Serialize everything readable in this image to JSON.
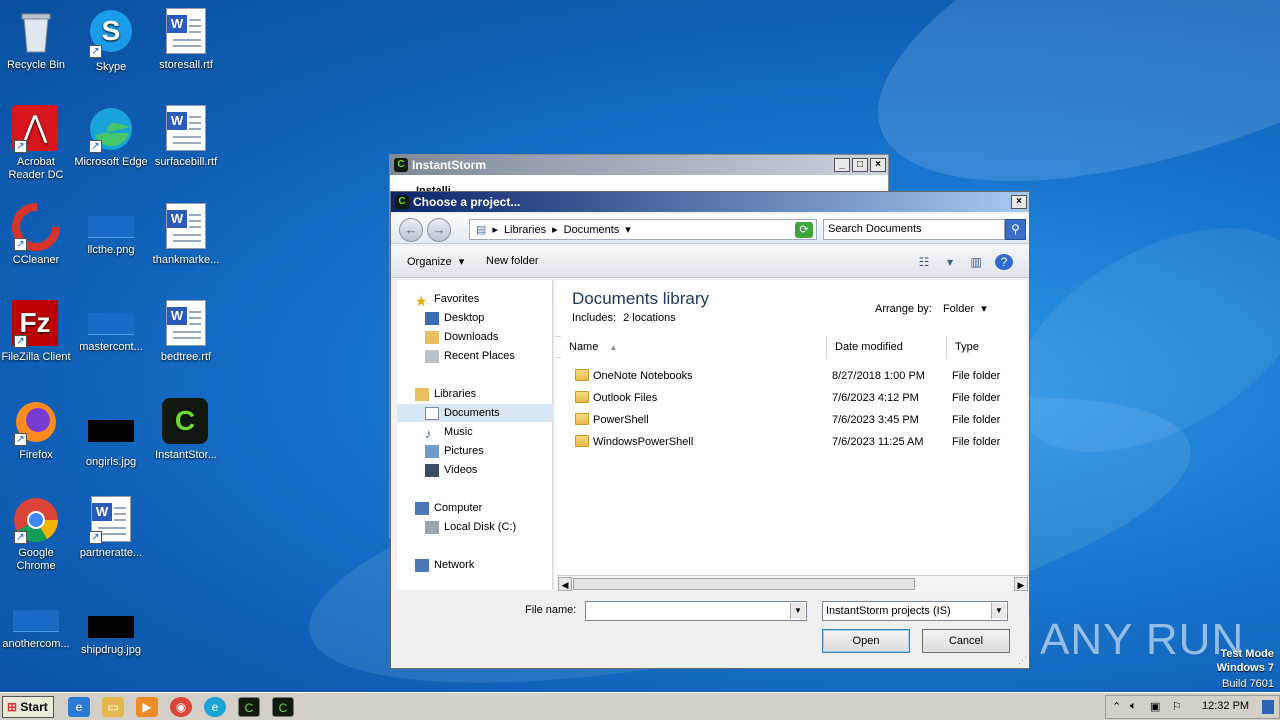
{
  "desktop": {
    "icons": [
      {
        "label": "Recycle Bin",
        "icon": "recycle-bin-icon"
      },
      {
        "label": "Skype",
        "icon": "skype-icon"
      },
      {
        "label": "storesall.rtf",
        "icon": "word-doc-icon"
      },
      {
        "label": "Acrobat Reader DC",
        "icon": "acrobat-icon"
      },
      {
        "label": "Microsoft Edge",
        "icon": "edge-icon"
      },
      {
        "label": "surfacebill.rtf",
        "icon": "word-doc-icon"
      },
      {
        "label": "CCleaner",
        "icon": "ccleaner-icon"
      },
      {
        "label": "llcthe.png",
        "icon": "image-thumb-icon"
      },
      {
        "label": "thankmarke...",
        "icon": "word-doc-icon"
      },
      {
        "label": "FileZilla Client",
        "icon": "filezilla-icon"
      },
      {
        "label": "mastercont...",
        "icon": "image-thumb-icon"
      },
      {
        "label": "bedtree.rtf",
        "icon": "word-doc-icon"
      },
      {
        "label": "Firefox",
        "icon": "firefox-icon"
      },
      {
        "label": "ongirls.jpg",
        "icon": "image-thumb-icon"
      },
      {
        "label": "InstantStor...",
        "icon": "instantstorm-icon"
      },
      {
        "label": "Google Chrome",
        "icon": "chrome-icon"
      },
      {
        "label": "partneratte...",
        "icon": "word-doc-icon"
      },
      {
        "label": "anothercom...",
        "icon": "image-thumb-icon"
      },
      {
        "label": "shipdrug.jpg",
        "icon": "image-thumb-icon"
      }
    ],
    "watermark": "ANY RUN",
    "test_mode": [
      "Test Mode",
      "Windows 7",
      "Build 7601"
    ]
  },
  "bg_window": {
    "title": "InstantStorm",
    "partial_text": "Installi"
  },
  "dialog": {
    "title": "Choose a project...",
    "breadcrumb": [
      "Libraries",
      "Documents"
    ],
    "search_placeholder": "Search Documents",
    "toolbar": {
      "organize": "Organize",
      "new_folder": "New folder"
    },
    "nav": {
      "favorites": "Favorites",
      "desktop": "Desktop",
      "downloads": "Downloads",
      "recent_places": "Recent Places",
      "libraries": "Libraries",
      "documents": "Documents",
      "music": "Music",
      "pictures": "Pictures",
      "videos": "Videos",
      "computer": "Computer",
      "local_disk": "Local Disk (C:)",
      "network": "Network"
    },
    "library": {
      "title": "Documents library",
      "includes_label": "Includes:",
      "includes_link": "2 locations",
      "arrange_by_label": "Arrange by:",
      "arrange_by_value": "Folder"
    },
    "columns": {
      "name": "Name",
      "date_modified": "Date modified",
      "type": "Type"
    },
    "files": [
      {
        "name": "OneNote Notebooks",
        "date": "8/27/2018 1:00 PM",
        "type": "File folder"
      },
      {
        "name": "Outlook Files",
        "date": "7/6/2023 4:12 PM",
        "type": "File folder"
      },
      {
        "name": "PowerShell",
        "date": "7/6/2023 3:45 PM",
        "type": "File folder"
      },
      {
        "name": "WindowsPowerShell",
        "date": "7/6/2023 11:25 AM",
        "type": "File folder"
      }
    ],
    "file_name_label": "File name:",
    "file_name_value": "",
    "filter_value": "InstantStorm projects (IS)",
    "open_label": "Open",
    "cancel_label": "Cancel"
  },
  "taskbar": {
    "start_label": "Start",
    "clock": "12:32 PM"
  }
}
